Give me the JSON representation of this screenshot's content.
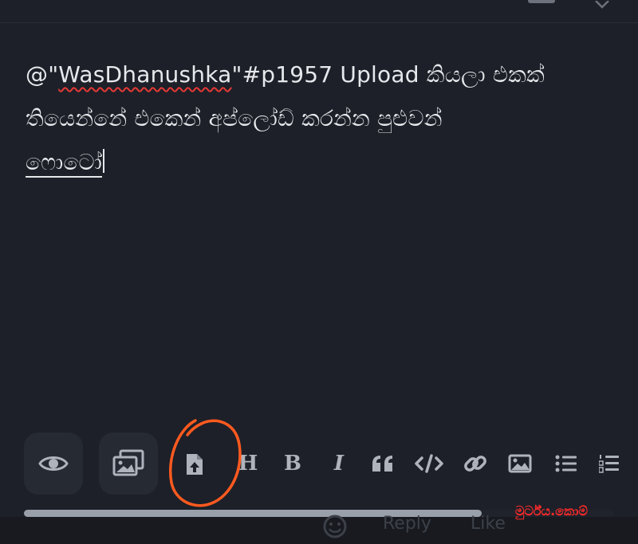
{
  "editor": {
    "mention_prefix": "@\"",
    "mention_name": "WasDhanushka",
    "mention_suffix": "\"#p1957 Upload කියලා එකක්",
    "line2": "තියෙන්නේ එකෙන් අප්ලෝඩ් කරන්න පුළුවන්",
    "line3": "ෆොටෝ"
  },
  "toolbar": {
    "preview": "eye-icon",
    "gallery": "images-icon",
    "upload": "file-upload-icon",
    "heading_label": "H",
    "bold_label": "B",
    "italic_label": "I",
    "quote": "quote-icon",
    "code": "code-icon",
    "link": "link-icon",
    "image": "image-icon",
    "bullet_list": "bullet-list-icon",
    "numbered_list": "numbered-list-icon"
  },
  "bottom_bar": {
    "reply_label": "Reply",
    "like_label": "Like"
  },
  "watermark": "මුර්ට්ය.කොම්",
  "colors": {
    "background": "#1d2028",
    "text": "#e6e8ec",
    "icon": "#aeb3bc",
    "annotation": "#ff5a1f",
    "watermark": "#ff2a2a",
    "spellcheck": "#e53935"
  }
}
